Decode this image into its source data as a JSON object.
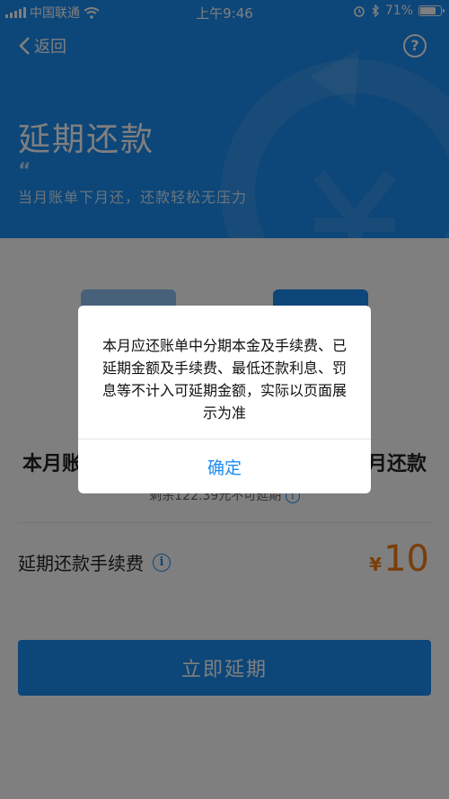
{
  "status_bar": {
    "carrier": "中国联通",
    "time": "上午9:46",
    "battery": "71%",
    "battery_level": 0.71
  },
  "nav": {
    "back_label": "返回",
    "help_symbol": "?"
  },
  "header": {
    "title": "延期还款",
    "quote_mark": "“",
    "subtitle": "当月账单下月还，还款轻松无压力"
  },
  "main": {
    "row_left_label": "本月账",
    "row_right_label": "月还款",
    "remaining_note": "剩余122.39元不可延期",
    "fee_label": "延期还款手续费",
    "fee_currency": "¥",
    "fee_value": "10",
    "primary_button": "立即延期"
  },
  "dialog": {
    "message": "本月应还账单中分期本金及手续费、已延期金额及手续费、最低还款利息、罚息等不计入可延期金额，实际以页面展示为准",
    "confirm_label": "确定"
  },
  "colors": {
    "primary": "#1a8cf0",
    "accent": "#f07d18"
  }
}
